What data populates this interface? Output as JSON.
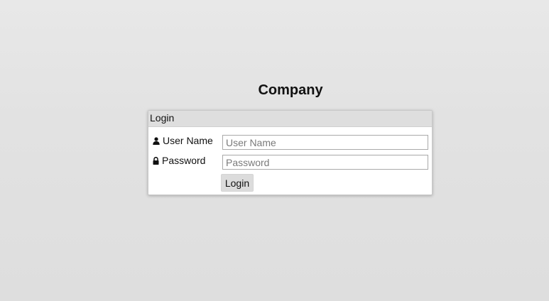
{
  "page": {
    "company_name": "Company"
  },
  "login_panel": {
    "header": "Login",
    "username": {
      "label": "User Name",
      "placeholder": "User Name",
      "value": "",
      "icon": "user-icon"
    },
    "password": {
      "label": "Password",
      "placeholder": "Password",
      "value": "",
      "icon": "lock-icon"
    },
    "submit_label": "Login"
  }
}
